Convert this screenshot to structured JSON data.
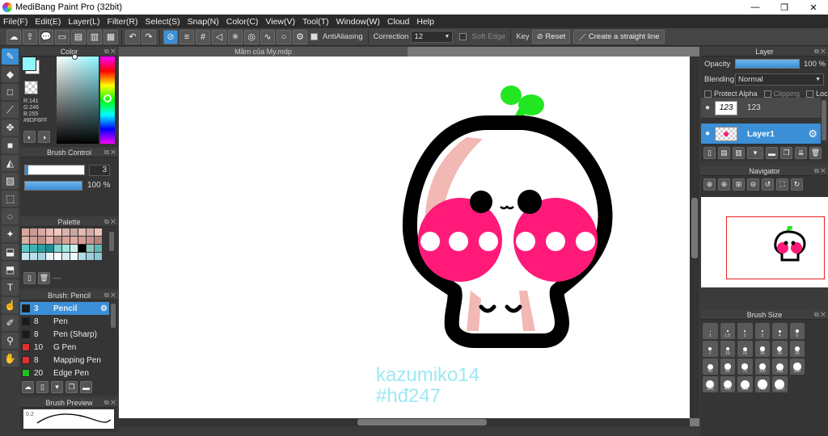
{
  "app": {
    "title": "MediBang Paint Pro (32bit)",
    "window_min": "—",
    "window_max": "❐",
    "window_close": "✕"
  },
  "menu": [
    "File(F)",
    "Edit(E)",
    "Layer(L)",
    "Filter(R)",
    "Select(S)",
    "Snap(N)",
    "Color(C)",
    "View(V)",
    "Tool(T)",
    "Window(W)",
    "Cloud",
    "Help"
  ],
  "toolbar": {
    "antialiasing": "AntiAliasing",
    "correction_label": "Correction",
    "correction_value": "12",
    "soft_edge": "Soft Edge",
    "key": "Key",
    "reset": "Reset",
    "straight_line": "Create a straight line"
  },
  "document": {
    "tab_title": "Mầm của My.mdp",
    "watermark_line1": "kazumiko14",
    "watermark_line2": "#hđ247"
  },
  "color_panel": {
    "title": "Color",
    "r": "R:141",
    "g": "G:246",
    "b": "B:255",
    "hex": "#8DF6FF",
    "fg_color": "#8DF6FF"
  },
  "brush_control": {
    "title": "Brush Control",
    "size_value": "3",
    "opacity_value": "100 %"
  },
  "palette": {
    "title": "Palette",
    "label": "----",
    "colors": [
      "#d9a79a",
      "#c99a93",
      "#d6a9a5",
      "#e8bcb6",
      "#f2c6c2",
      "#d7b4ad",
      "#c9a6a0",
      "#e0b9b2",
      "#d1aaa3",
      "#eac3bd",
      "#d8b0a8",
      "#d09d96",
      "#c4918a",
      "#e6b4ac",
      "#b88f88",
      "#d7a098",
      "#e2aaa2",
      "#d99b95",
      "#c7938d",
      "#b8837e",
      "#5ec8c6",
      "#3fb3b3",
      "#2aa0a0",
      "#1f8f93",
      "#7fd3d0",
      "#9ee3e0",
      "#c9f2ef",
      "#000000",
      "#8ac9c2",
      "#5fb8b0",
      "#c8e8f0",
      "#b8e0ea",
      "#a8d6e3",
      "#e6f5f8",
      "#ffffff",
      "#d7eef3",
      "#f0fbfd",
      "#b0dbe6",
      "#9dd0de",
      "#8cc7d6"
    ]
  },
  "brush_list": {
    "title": "Brush: Pencil",
    "items": [
      {
        "size": "3",
        "name": "Pencil",
        "color": "#1a1a1a"
      },
      {
        "size": "8",
        "name": "Pen",
        "color": "#1a1a1a"
      },
      {
        "size": "8",
        "name": "Pen (Sharp)",
        "color": "#1a1a1a"
      },
      {
        "size": "10",
        "name": "G Pen",
        "color": "#e03030"
      },
      {
        "size": "8",
        "name": "Mapping Pen",
        "color": "#e03030"
      },
      {
        "size": "20",
        "name": "Edge Pen",
        "color": "#20c020"
      }
    ]
  },
  "brush_preview": {
    "title": "Brush Preview",
    "value": "0.2"
  },
  "layer_panel": {
    "title": "Layer",
    "opacity_label": "Opacity",
    "opacity_value": "100 %",
    "blending_label": "Blending",
    "blending_value": "Normal",
    "protect_alpha": "Protect Alpha",
    "clipping": "Clipping",
    "lock": "Lock",
    "layers": [
      {
        "name": "123",
        "thumb": "123"
      },
      {
        "name": "Layer1"
      }
    ]
  },
  "navigator": {
    "title": "Navigator"
  },
  "brush_size": {
    "title": "Brush Size",
    "sizes": [
      "1",
      "1.5",
      "2",
      "3",
      "4",
      "5",
      "7",
      "10",
      "15",
      "20",
      "25",
      "30",
      "40",
      "50",
      "70",
      "100",
      "150",
      "200",
      "300",
      "400",
      "500",
      "700",
      "1000"
    ]
  }
}
